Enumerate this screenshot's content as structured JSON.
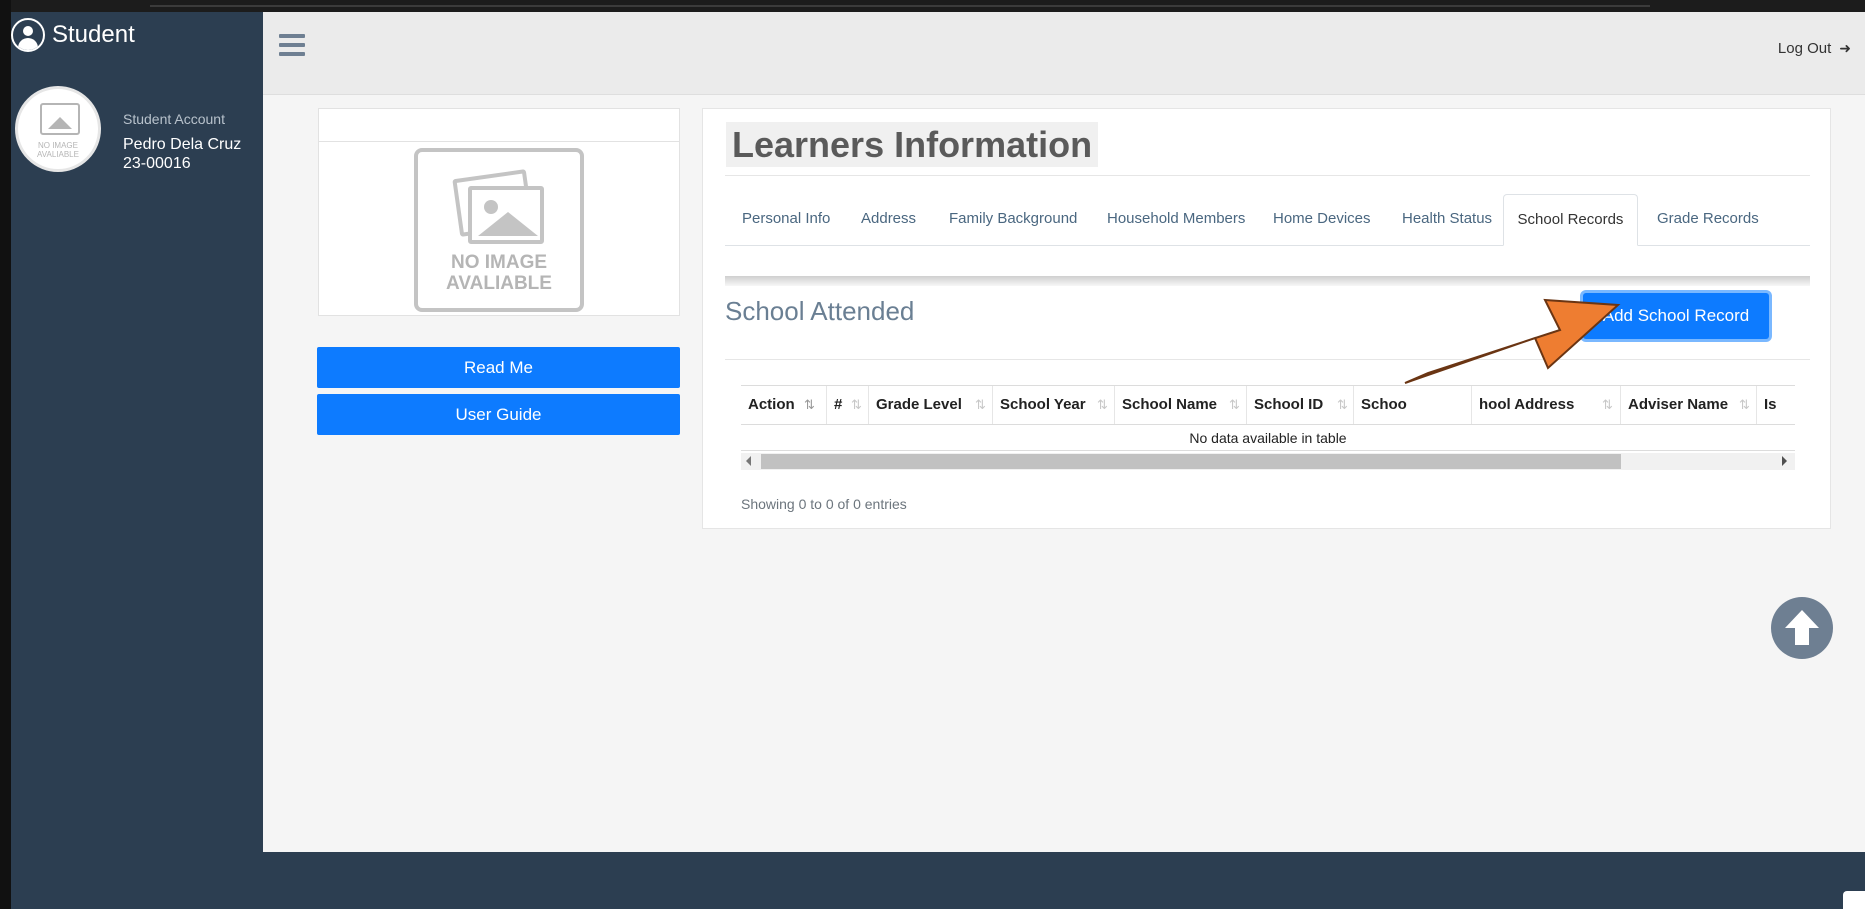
{
  "brand": {
    "title": "Student"
  },
  "profile": {
    "role": "Student Account",
    "name": "Pedro Dela Cruz",
    "id": "23-00016",
    "avatar_text": "NO IMAGE AVALIABLE"
  },
  "header": {
    "logout_label": "Log Out",
    "logout_icon": "sign-out-icon",
    "menu_icon": "hamburger-icon"
  },
  "photo": {
    "placeholder_text": "NO IMAGE AVALIABLE"
  },
  "buttons": {
    "read_me": "Read Me",
    "user_guide": "User Guide"
  },
  "card": {
    "title": "Learners Information",
    "tabs": [
      {
        "label": "Personal Info",
        "active": false
      },
      {
        "label": "Address",
        "active": false
      },
      {
        "label": "Family Background",
        "active": false
      },
      {
        "label": "Household Members",
        "active": false
      },
      {
        "label": "Home Devices",
        "active": false
      },
      {
        "label": "Health Status",
        "active": false
      },
      {
        "label": "School Records",
        "active": true
      },
      {
        "label": "Grade Records",
        "active": false
      }
    ],
    "section_title": "School Attended",
    "add_button": "Add School Record"
  },
  "table": {
    "columns": [
      "Action",
      "#",
      "Grade Level",
      "School Year",
      "School Name",
      "School ID",
      "Schoo",
      "hool Address",
      "Adviser Name",
      "Is"
    ],
    "empty_message": "No data available in table",
    "info": "Showing 0 to 0 of 0 entries"
  },
  "colors": {
    "sidebar": "#2c3e51",
    "primary": "#0d7bff",
    "annotation_arrow": "#ee7d31"
  }
}
